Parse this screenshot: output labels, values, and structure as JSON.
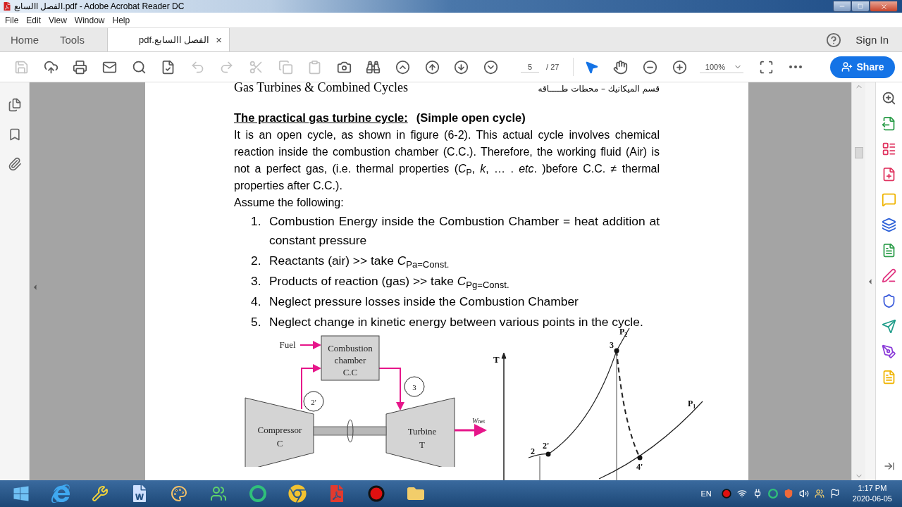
{
  "window": {
    "title": "الفصل االسابع.pdf - Adobe Acrobat Reader DC"
  },
  "menu": [
    "File",
    "Edit",
    "View",
    "Window",
    "Help"
  ],
  "tabs": [
    {
      "label": "Home",
      "selected": false,
      "kind": "nav"
    },
    {
      "label": "Tools",
      "selected": false,
      "kind": "nav"
    },
    {
      "label": "الفصل االسابع.pdf",
      "selected": true,
      "kind": "document",
      "close": "×"
    }
  ],
  "account": {
    "sign_in": "Sign In"
  },
  "toolbar": {
    "buttons": [
      {
        "kind": "save",
        "disabled": true
      },
      {
        "kind": "upload",
        "disabled": false
      },
      {
        "kind": "print",
        "disabled": false
      },
      {
        "kind": "mail",
        "disabled": false
      },
      {
        "kind": "find",
        "disabled": false
      },
      {
        "kind": "certify",
        "disabled": false
      },
      {
        "kind": "undo",
        "disabled": true
      },
      {
        "kind": "redo",
        "disabled": true
      },
      {
        "kind": "cut",
        "disabled": true
      },
      {
        "kind": "copy",
        "disabled": true
      },
      {
        "kind": "paste",
        "disabled": true
      },
      {
        "kind": "snapshot",
        "disabled": false
      },
      {
        "kind": "search",
        "disabled": false
      },
      {
        "kind": "first",
        "disabled": false
      },
      {
        "kind": "previous",
        "disabled": false
      },
      {
        "kind": "next",
        "disabled": false
      },
      {
        "kind": "last",
        "disabled": false
      }
    ],
    "page": {
      "current": "5",
      "total": "/ 27"
    },
    "tools": [
      {
        "kind": "select",
        "selected": true
      },
      {
        "kind": "hand",
        "selected": false
      },
      {
        "kind": "zoom_out",
        "selected": false
      },
      {
        "kind": "zoom_in",
        "selected": false
      }
    ],
    "zoom": "100%",
    "share": "Share"
  },
  "document": {
    "running_head": {
      "left": "Gas Turbines & Combined Cycles",
      "right": "قسم الميكانيك – محطات طـــــاقه"
    },
    "heading": {
      "title": "The practical gas turbine cycle:",
      "note": "(Simple open cycle)"
    },
    "paragraph": "It is an open cycle, as shown in figure (6-2). This actual cycle involves chemical reaction inside the combustion chamber (C.C.). Therefore, the working fluid (Air) is not a perfect gas, (i.e. thermal properties (*C*$_{P}$, *k*, … . *etc*. )before C.C. ≠ thermal properties after C.C.).",
    "intro": "Assume the following:",
    "assumptions": [
      {
        "number": "1.",
        "text": "Combustion Energy inside the Combustion Chamber = heat addition at constant pressure"
      },
      {
        "number": "2.",
        "text": "Reactants (air) >> take *C*$_{Pa=Const.}$"
      },
      {
        "number": "3.",
        "text": "Products of reaction (gas) >> take *C*$_{Pg=Const.}$"
      },
      {
        "number": "4.",
        "text": "Neglect pressure losses inside the Combustion Chamber"
      },
      {
        "number": "5.",
        "text": "Neglect change in kinetic energy between various points in the cycle."
      }
    ],
    "schematic": {
      "fuel": "Fuel",
      "chamber": [
        "Combustion",
        "chamber",
        "C.C"
      ],
      "state_in": "2'",
      "state_out": "3",
      "compressor": [
        "Compressor",
        "C"
      ],
      "turbine": [
        "Turbine",
        "T"
      ],
      "work": {
        "symbol": "W",
        "subscript": "net"
      }
    },
    "ts_diagram": {
      "axis": "T",
      "high_pressure": {
        "symbol": "P",
        "subscript": "2"
      },
      "low_pressure": {
        "symbol": "P",
        "subscript": "1"
      },
      "points": [
        "3",
        "2",
        "2'",
        "4'"
      ]
    }
  },
  "taskbar": {
    "language": "EN",
    "time": "1:17 PM",
    "date": "2020-06-05"
  }
}
